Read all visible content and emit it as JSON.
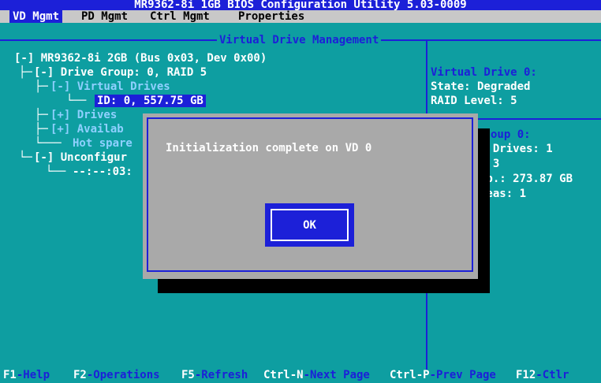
{
  "title": "MR9362-8i 1GB BIOS Configuration Utility 5.03-0009",
  "menu": {
    "vd_mgmt": "VD Mgmt",
    "pd_mgmt": "PD Mgmt",
    "ctrl_mgmt": "Ctrl Mgmt",
    "properties": "Properties"
  },
  "panel_title": "Virtual Drive Management",
  "tree": {
    "controller": "[-] MR9362-8i 2GB (Bus 0x03, Dev 0x00)",
    "drive_group": "[-] Drive Group: 0, RAID 5",
    "virtual_drives": "[-] Virtual Drives",
    "vd_item": "ID: 0, 557.75 GB",
    "drives": "[+] Drives",
    "available": "[+] Availab",
    "hot_spare": "Hot spare",
    "unconfigured": "[-] Unconfigur",
    "unconf_item": "--:--:03:"
  },
  "side_info": {
    "vd_heading": "Virtual Drive 0:",
    "state": "State: Degraded",
    "raid_level": "RAID Level: 5",
    "dg_heading": "oup 0:",
    "drives": "l Drives: 1",
    "count": ": 3",
    "cap": "ap.: 273.87 GB",
    "areas": "reas: 1"
  },
  "dialog": {
    "message": "Initialization complete on VD 0",
    "ok_label": "OK"
  },
  "help_bar": [
    {
      "key": "F1",
      "desc": "-Help"
    },
    {
      "key": "F2",
      "desc": "-Operations"
    },
    {
      "key": "F5",
      "desc": "-Refresh"
    },
    {
      "key": "Ctrl-N",
      "desc": "-Next Page"
    },
    {
      "key": "Ctrl-P",
      "desc": "-Prev Page"
    },
    {
      "key": "F12",
      "desc": "-Ctlr"
    }
  ],
  "colors": {
    "background": "#0e9ea1",
    "accent_blue": "#1c20d8",
    "dialog_gray": "#a9a9a9"
  }
}
